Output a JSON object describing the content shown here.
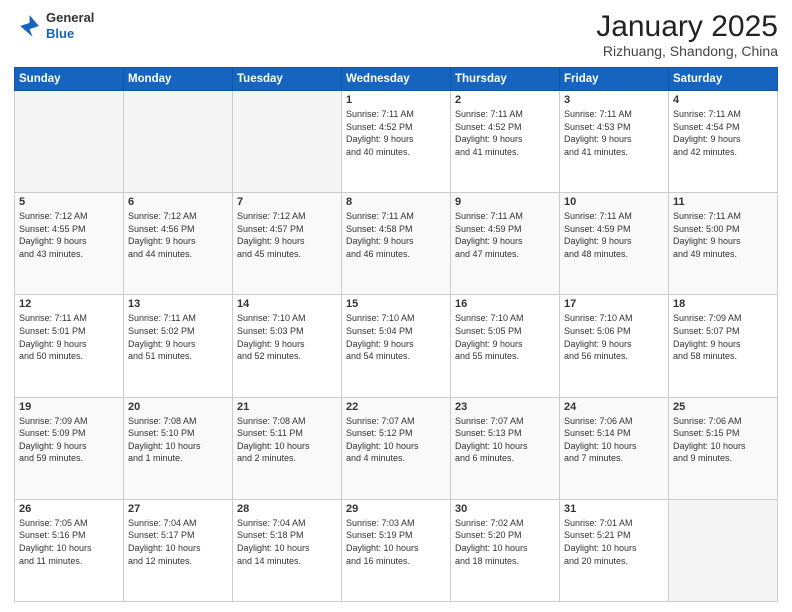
{
  "header": {
    "logo_line1": "General",
    "logo_line2": "Blue",
    "title": "January 2025",
    "subtitle": "Rizhuang, Shandong, China"
  },
  "calendar": {
    "days_of_week": [
      "Sunday",
      "Monday",
      "Tuesday",
      "Wednesday",
      "Thursday",
      "Friday",
      "Saturday"
    ],
    "weeks": [
      [
        {
          "day": "",
          "content": ""
        },
        {
          "day": "",
          "content": ""
        },
        {
          "day": "",
          "content": ""
        },
        {
          "day": "1",
          "content": "Sunrise: 7:11 AM\nSunset: 4:52 PM\nDaylight: 9 hours\nand 40 minutes."
        },
        {
          "day": "2",
          "content": "Sunrise: 7:11 AM\nSunset: 4:52 PM\nDaylight: 9 hours\nand 41 minutes."
        },
        {
          "day": "3",
          "content": "Sunrise: 7:11 AM\nSunset: 4:53 PM\nDaylight: 9 hours\nand 41 minutes."
        },
        {
          "day": "4",
          "content": "Sunrise: 7:11 AM\nSunset: 4:54 PM\nDaylight: 9 hours\nand 42 minutes."
        }
      ],
      [
        {
          "day": "5",
          "content": "Sunrise: 7:12 AM\nSunset: 4:55 PM\nDaylight: 9 hours\nand 43 minutes."
        },
        {
          "day": "6",
          "content": "Sunrise: 7:12 AM\nSunset: 4:56 PM\nDaylight: 9 hours\nand 44 minutes."
        },
        {
          "day": "7",
          "content": "Sunrise: 7:12 AM\nSunset: 4:57 PM\nDaylight: 9 hours\nand 45 minutes."
        },
        {
          "day": "8",
          "content": "Sunrise: 7:11 AM\nSunset: 4:58 PM\nDaylight: 9 hours\nand 46 minutes."
        },
        {
          "day": "9",
          "content": "Sunrise: 7:11 AM\nSunset: 4:59 PM\nDaylight: 9 hours\nand 47 minutes."
        },
        {
          "day": "10",
          "content": "Sunrise: 7:11 AM\nSunset: 4:59 PM\nDaylight: 9 hours\nand 48 minutes."
        },
        {
          "day": "11",
          "content": "Sunrise: 7:11 AM\nSunset: 5:00 PM\nDaylight: 9 hours\nand 49 minutes."
        }
      ],
      [
        {
          "day": "12",
          "content": "Sunrise: 7:11 AM\nSunset: 5:01 PM\nDaylight: 9 hours\nand 50 minutes."
        },
        {
          "day": "13",
          "content": "Sunrise: 7:11 AM\nSunset: 5:02 PM\nDaylight: 9 hours\nand 51 minutes."
        },
        {
          "day": "14",
          "content": "Sunrise: 7:10 AM\nSunset: 5:03 PM\nDaylight: 9 hours\nand 52 minutes."
        },
        {
          "day": "15",
          "content": "Sunrise: 7:10 AM\nSunset: 5:04 PM\nDaylight: 9 hours\nand 54 minutes."
        },
        {
          "day": "16",
          "content": "Sunrise: 7:10 AM\nSunset: 5:05 PM\nDaylight: 9 hours\nand 55 minutes."
        },
        {
          "day": "17",
          "content": "Sunrise: 7:10 AM\nSunset: 5:06 PM\nDaylight: 9 hours\nand 56 minutes."
        },
        {
          "day": "18",
          "content": "Sunrise: 7:09 AM\nSunset: 5:07 PM\nDaylight: 9 hours\nand 58 minutes."
        }
      ],
      [
        {
          "day": "19",
          "content": "Sunrise: 7:09 AM\nSunset: 5:09 PM\nDaylight: 9 hours\nand 59 minutes."
        },
        {
          "day": "20",
          "content": "Sunrise: 7:08 AM\nSunset: 5:10 PM\nDaylight: 10 hours\nand 1 minute."
        },
        {
          "day": "21",
          "content": "Sunrise: 7:08 AM\nSunset: 5:11 PM\nDaylight: 10 hours\nand 2 minutes."
        },
        {
          "day": "22",
          "content": "Sunrise: 7:07 AM\nSunset: 5:12 PM\nDaylight: 10 hours\nand 4 minutes."
        },
        {
          "day": "23",
          "content": "Sunrise: 7:07 AM\nSunset: 5:13 PM\nDaylight: 10 hours\nand 6 minutes."
        },
        {
          "day": "24",
          "content": "Sunrise: 7:06 AM\nSunset: 5:14 PM\nDaylight: 10 hours\nand 7 minutes."
        },
        {
          "day": "25",
          "content": "Sunrise: 7:06 AM\nSunset: 5:15 PM\nDaylight: 10 hours\nand 9 minutes."
        }
      ],
      [
        {
          "day": "26",
          "content": "Sunrise: 7:05 AM\nSunset: 5:16 PM\nDaylight: 10 hours\nand 11 minutes."
        },
        {
          "day": "27",
          "content": "Sunrise: 7:04 AM\nSunset: 5:17 PM\nDaylight: 10 hours\nand 12 minutes."
        },
        {
          "day": "28",
          "content": "Sunrise: 7:04 AM\nSunset: 5:18 PM\nDaylight: 10 hours\nand 14 minutes."
        },
        {
          "day": "29",
          "content": "Sunrise: 7:03 AM\nSunset: 5:19 PM\nDaylight: 10 hours\nand 16 minutes."
        },
        {
          "day": "30",
          "content": "Sunrise: 7:02 AM\nSunset: 5:20 PM\nDaylight: 10 hours\nand 18 minutes."
        },
        {
          "day": "31",
          "content": "Sunrise: 7:01 AM\nSunset: 5:21 PM\nDaylight: 10 hours\nand 20 minutes."
        },
        {
          "day": "",
          "content": ""
        }
      ]
    ]
  }
}
